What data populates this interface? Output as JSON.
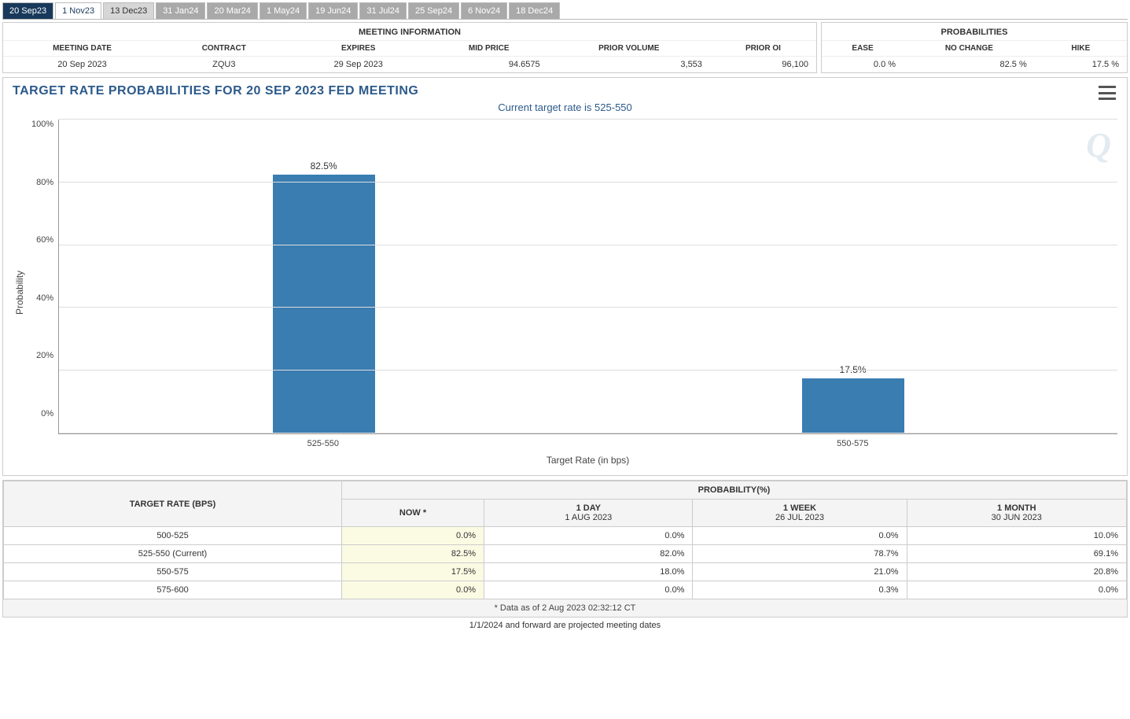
{
  "tabs": [
    {
      "label": "20 Sep23",
      "state": "active"
    },
    {
      "label": "1 Nov23",
      "state": "light"
    },
    {
      "label": "13 Dec23",
      "state": "lightgrey"
    },
    {
      "label": "31 Jan24",
      "state": "grey"
    },
    {
      "label": "20 Mar24",
      "state": "grey"
    },
    {
      "label": "1 May24",
      "state": "grey"
    },
    {
      "label": "19 Jun24",
      "state": "grey"
    },
    {
      "label": "31 Jul24",
      "state": "grey"
    },
    {
      "label": "25 Sep24",
      "state": "grey"
    },
    {
      "label": "6 Nov24",
      "state": "grey"
    },
    {
      "label": "18 Dec24",
      "state": "grey"
    }
  ],
  "meeting_info": {
    "title": "MEETING INFORMATION",
    "headers": [
      "MEETING DATE",
      "CONTRACT",
      "EXPIRES",
      "MID PRICE",
      "PRIOR VOLUME",
      "PRIOR OI"
    ],
    "row": [
      "20 Sep 2023",
      "ZQU3",
      "29 Sep 2023",
      "94.6575",
      "3,553",
      "96,100"
    ]
  },
  "probabilities": {
    "title": "PROBABILITIES",
    "headers": [
      "EASE",
      "NO CHANGE",
      "HIKE"
    ],
    "row": [
      "0.0 %",
      "82.5 %",
      "17.5 %"
    ]
  },
  "chart": {
    "title": "TARGET RATE PROBABILITIES FOR 20 SEP 2023 FED MEETING",
    "subtitle": "Current target rate is 525-550",
    "ylabel": "Probability",
    "xlabel": "Target Rate (in bps)",
    "yticks": [
      "100%",
      "80%",
      "60%",
      "40%",
      "20%",
      "0%"
    ],
    "watermark": "Q"
  },
  "chart_data": {
    "type": "bar",
    "title": "TARGET RATE PROBABILITIES FOR 20 SEP 2023 FED MEETING",
    "subtitle": "Current target rate is 525-550",
    "xlabel": "Target Rate (in bps)",
    "ylabel": "Probability",
    "ylim": [
      0,
      100
    ],
    "categories": [
      "525-550",
      "550-575"
    ],
    "values": [
      82.5,
      17.5
    ],
    "value_labels": [
      "82.5%",
      "17.5%"
    ]
  },
  "history": {
    "rate_header": "TARGET RATE (BPS)",
    "prob_header": "PROBABILITY(%)",
    "cols": [
      {
        "main": "NOW *",
        "sub": ""
      },
      {
        "main": "1 DAY",
        "sub": "1 AUG 2023"
      },
      {
        "main": "1 WEEK",
        "sub": "26 JUL 2023"
      },
      {
        "main": "1 MONTH",
        "sub": "30 JUN 2023"
      }
    ],
    "rows": [
      {
        "rate": "500-525",
        "vals": [
          "0.0%",
          "0.0%",
          "0.0%",
          "10.0%"
        ]
      },
      {
        "rate": "525-550 (Current)",
        "vals": [
          "82.5%",
          "82.0%",
          "78.7%",
          "69.1%"
        ]
      },
      {
        "rate": "550-575",
        "vals": [
          "17.5%",
          "18.0%",
          "21.0%",
          "20.8%"
        ]
      },
      {
        "rate": "575-600",
        "vals": [
          "0.0%",
          "0.0%",
          "0.3%",
          "0.0%"
        ]
      }
    ],
    "footnote": "* Data as of 2 Aug 2023 02:32:12 CT"
  },
  "projection_note": "1/1/2024 and forward are projected meeting dates"
}
